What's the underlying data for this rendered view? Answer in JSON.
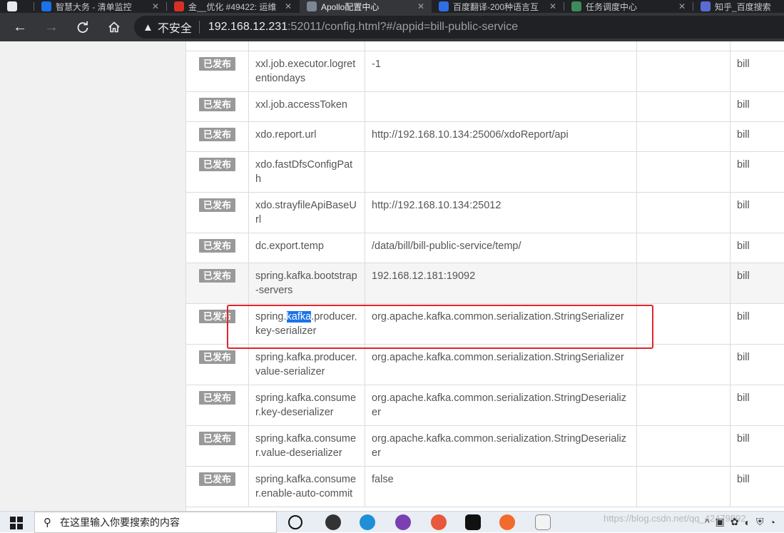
{
  "browser": {
    "tabs": [
      {
        "label": "智慧大务 - 清单监控",
        "active": false,
        "color": "#1a73e8"
      },
      {
        "label": "金__优化 #49422: 运维",
        "active": false,
        "color": "#d93025"
      },
      {
        "label": "Apollo配置中心",
        "active": true,
        "color": "#7b8794"
      },
      {
        "label": "百度翻译-200种语言互",
        "active": false,
        "color": "#2f6fe4"
      },
      {
        "label": "任务调度中心",
        "active": false,
        "color": "#3c8d5a"
      },
      {
        "label": "知乎_百度搜索",
        "active": false,
        "color": "#5b6bd6"
      }
    ],
    "security_label": "不安全",
    "url_host": "192.168.12.231",
    "url_rest": ":52011/config.html?#/appid=bill-public-service"
  },
  "config_table": {
    "rows": [
      {
        "status": "已发布",
        "key": "xxl.job.executor.logretentiondays",
        "value": "-1",
        "comment": "",
        "user": "bill"
      },
      {
        "status": "已发布",
        "key": "xxl.job.accessToken",
        "value": "",
        "comment": "",
        "user": "bill"
      },
      {
        "status": "已发布",
        "key": "xdo.report.url",
        "value": "http://192.168.10.134:25006/xdoReport/api",
        "comment": "",
        "user": "bill"
      },
      {
        "status": "已发布",
        "key": "xdo.fastDfsConfigPath",
        "value": "",
        "comment": "",
        "user": "bill"
      },
      {
        "status": "已发布",
        "key": "xdo.strayfileApiBaseUrl",
        "value": "http://192.168.10.134:25012",
        "comment": "",
        "user": "bill"
      },
      {
        "status": "已发布",
        "key": "dc.export.temp",
        "value": "/data/bill/bill-public-service/temp/",
        "comment": "",
        "user": "bill"
      },
      {
        "status": "已发布",
        "key": "spring.kafka.bootstrap-servers",
        "value": "192.168.12.181:19092",
        "comment": "",
        "user": "bill"
      },
      {
        "status": "已发布",
        "key_prefix": "spring.",
        "key_highlight": "kafka",
        "key_suffix": ".producer.key-serializer",
        "value": "org.apache.kafka.common.serialization.StringSerializer",
        "comment": "",
        "user": "bill"
      },
      {
        "status": "已发布",
        "key": "spring.kafka.producer.value-serializer",
        "value": "org.apache.kafka.common.serialization.StringSerializer",
        "comment": "",
        "user": "bill"
      },
      {
        "status": "已发布",
        "key": "spring.kafka.consumer.key-deserializer",
        "value": "org.apache.kafka.common.serialization.StringDeserializer",
        "comment": "",
        "user": "bill"
      },
      {
        "status": "已发布",
        "key": "spring.kafka.consumer.value-deserializer",
        "value": "org.apache.kafka.common.serialization.StringDeserializer",
        "comment": "",
        "user": "bill"
      },
      {
        "status": "已发布",
        "key": "spring.kafka.consumer.enable-auto-commit",
        "value": "false",
        "comment": "",
        "user": "bill"
      }
    ]
  },
  "taskbar": {
    "search_placeholder": "在这里输入你要搜索的内容",
    "watermark": "https://blog.csdn.net/qq_42479892"
  }
}
